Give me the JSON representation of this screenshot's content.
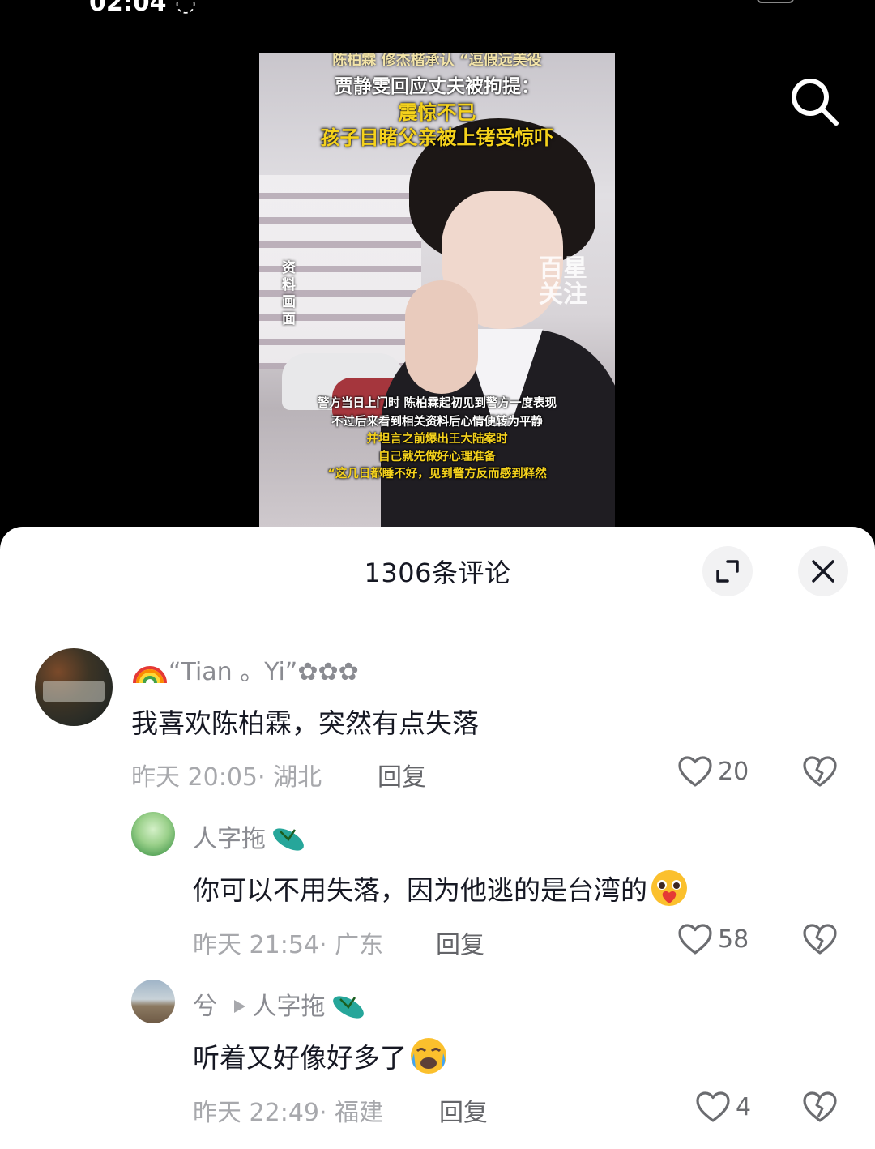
{
  "video": {
    "caption_top": "陈柏霖 修杰楷承认 “逗假远美役",
    "caption_line1": "贾静雯回应丈夫被拘提：",
    "caption_line2": "震惊不已",
    "caption_line3": "孩子目睹父亲被上铐受惊吓",
    "side_label": "资料画面",
    "watermark": "百星关注",
    "subtitles": [
      "警方当日上门时 陈柏霖起初见到警方一度表现",
      "不过后来看到相关资料后心情便转为平静",
      "并坦言之前爆出王大陆案时",
      "自己就先做好心理准备",
      "“这几日都睡不好，见到警方反而感到释然"
    ]
  },
  "sheet": {
    "title": "1306条评论"
  },
  "comments": [
    {
      "username": "“Tian 。Yi”✿✿✿",
      "text": "我喜欢陈柏霖，突然有点失落",
      "meta": "昨天 20:05· 湖北",
      "reply_label": "回复",
      "likes": "20"
    },
    {
      "username": "人字拖",
      "text": "你可以不用失落，因为他逃的是台湾的",
      "meta": "昨天 21:54· 广东",
      "reply_label": "回复",
      "likes": "58"
    },
    {
      "username": "兮",
      "reply_to": "人字拖",
      "text": "听着又好像好多了",
      "meta": "昨天 22:49· 福建",
      "reply_label": "回复",
      "likes": "4"
    }
  ],
  "colors": {
    "sheet_bg": "#ffffff",
    "primary_text": "#161823",
    "secondary_text": "#8a8b91",
    "caption_yellow": "#f5d21c"
  },
  "icons": [
    "search-icon",
    "expand-icon",
    "close-icon",
    "heart-icon",
    "broken-heart-icon",
    "rainbow-icon",
    "flip-flop-icon",
    "triangle-right-icon"
  ]
}
